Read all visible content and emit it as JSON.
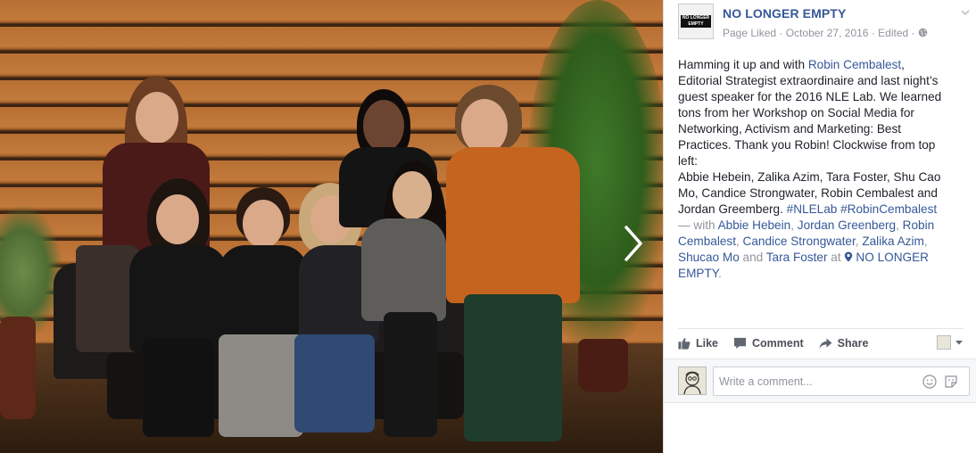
{
  "page": {
    "name": "NO LONGER EMPTY",
    "logo_text": "NO LONGER EMPTY",
    "meta_liked": "Page Liked",
    "meta_date": "October 27, 2016",
    "meta_edited": "Edited",
    "meta_sep": "·"
  },
  "post": {
    "intro": "Hamming it up and with ",
    "mention_main": "Robin Cembalest",
    "body": ", Editorial Strategist extraordinaire and last night’s guest speaker for the 2016 NLE Lab. We learned tons from her Workshop on Social Media for Networking, Activism and Marketing: Best Practices. Thank you Robin! Clockwise from top left:",
    "names_line": "Abbie Hebein, Zalika Azim, Tara Foster, Shu Cao Mo, Candice Strongwater, Robin Cembalest and Jordan Greemberg. ",
    "hashtag1": "#NLELab",
    "hashtag2": "#RobinCembalest",
    "with_label": " — with ",
    "tags": [
      "Abbie Hebein",
      "Jordan Greenberg",
      "Robin Cembalest",
      "Candice Strongwater",
      "Zalika Azim",
      "Shucao Mo",
      "Tara Foster"
    ],
    "comma": ", ",
    "and_word": " and ",
    "at_word": " at ",
    "location": "NO LONGER EMPTY",
    "period": "."
  },
  "actions": {
    "like": "Like",
    "comment": "Comment",
    "share": "Share"
  },
  "comment": {
    "placeholder": "Write a comment..."
  },
  "icons": {
    "next": "chevron-right-icon",
    "globe": "globe-icon",
    "menu": "chevron-down-icon",
    "like": "thumbs-up-icon",
    "comment": "speech-bubble-icon",
    "share": "share-arrow-icon",
    "emoji": "smiley-icon",
    "sticker": "sticker-icon",
    "location": "map-pin-icon"
  },
  "colors": {
    "link": "#365899",
    "text": "#1d2129",
    "meta": "#90949c"
  }
}
